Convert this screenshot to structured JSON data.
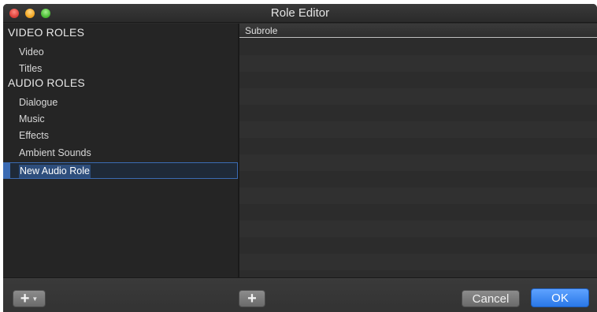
{
  "window": {
    "title": "Role Editor"
  },
  "sidebar": {
    "video_header": "VIDEO ROLES",
    "video_roles": [
      "Video",
      "Titles"
    ],
    "audio_header": "AUDIO ROLES",
    "audio_roles": [
      "Dialogue",
      "Music",
      "Effects",
      "Ambient Sounds"
    ],
    "editing_role": "New Audio Role"
  },
  "subroles": {
    "column_header": "Subrole",
    "rows": []
  },
  "footer": {
    "add_role_icon": "plus-icon",
    "add_role_menu_icon": "chevron-down-icon",
    "add_subrole_icon": "plus-icon",
    "cancel_label": "Cancel",
    "ok_label": "OK"
  },
  "colors": {
    "accent": "#2a78e8",
    "selection_border": "#3b6bb3",
    "background": "#2b2b2b"
  }
}
